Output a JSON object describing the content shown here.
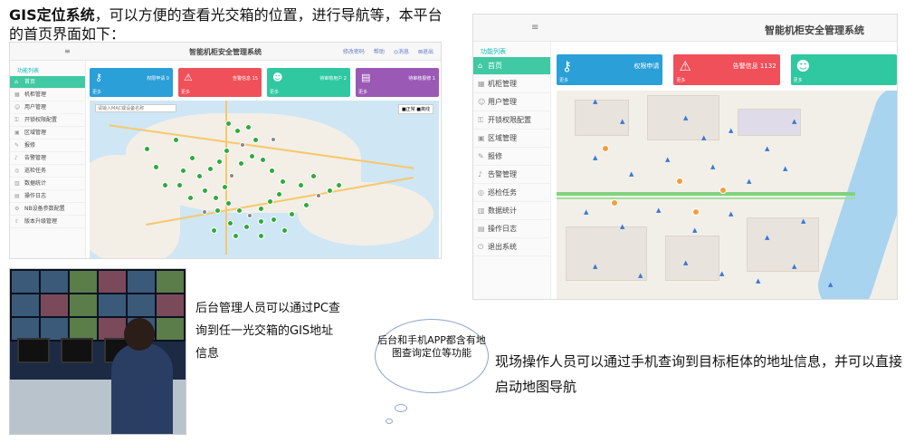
{
  "intro": {
    "bold": "GIS定位系统",
    "rest": "，可以方便的查看光交箱的位置，进行导航等，本平台的首页界面如下："
  },
  "left_shot": {
    "menu_icon": "≡",
    "title": "智能机柜安全管理系统",
    "links": [
      "修改密码",
      "帮助",
      "◎消息",
      "⊠退出"
    ],
    "sidebar_header": "功能列表",
    "sidebar": [
      {
        "label": "首页",
        "icon": "home-icon",
        "glyph": "⌂",
        "active": true
      },
      {
        "label": "机柜管理",
        "icon": "cabinet-icon",
        "glyph": "▦"
      },
      {
        "label": "用户管理",
        "icon": "user-icon",
        "glyph": "☺"
      },
      {
        "label": "开锁权限配置",
        "icon": "key-icon",
        "glyph": "⚿"
      },
      {
        "label": "区域管理",
        "icon": "region-icon",
        "glyph": "▣"
      },
      {
        "label": "报修",
        "icon": "wrench-icon",
        "glyph": "✎"
      },
      {
        "label": "告警管理",
        "icon": "bell-icon",
        "glyph": "♪"
      },
      {
        "label": "巡检任务",
        "icon": "task-icon",
        "glyph": "◎"
      },
      {
        "label": "数据统计",
        "icon": "chart-icon",
        "glyph": "▥"
      },
      {
        "label": "操作日志",
        "icon": "log-icon",
        "glyph": "▤"
      },
      {
        "label": "NB设备参数配置",
        "icon": "device-icon",
        "glyph": "⚙"
      },
      {
        "label": "版本升级管理",
        "icon": "upgrade-icon",
        "glyph": "⇧"
      }
    ],
    "cards": [
      {
        "label": "权限申请 0",
        "more": "更多",
        "color": "#2a9fd8",
        "icon": "key-icon",
        "glyph": "⚷"
      },
      {
        "label": "告警信息 15",
        "more": "更多",
        "color": "#f0505a",
        "icon": "warning-icon",
        "glyph": "⚠"
      },
      {
        "label": "待审核用户 2",
        "more": "更多",
        "color": "#2fc8a0",
        "icon": "user-icon",
        "glyph": "☻"
      },
      {
        "label": "待审核报修 1",
        "more": "更多",
        "color": "#9b59b6",
        "icon": "clipboard-icon",
        "glyph": "▤"
      }
    ],
    "map_search_placeholder": "请输入MAC或设备名称",
    "map_legend": "■正常 ■离线"
  },
  "right_shot": {
    "menu_icon": "≡",
    "title": "智能机柜安全管理系统",
    "sidebar_header": "功能列表",
    "sidebar": [
      {
        "label": "首页",
        "icon": "home-icon",
        "glyph": "⌂",
        "active": true
      },
      {
        "label": "机柜管理",
        "icon": "cabinet-icon",
        "glyph": "▦"
      },
      {
        "label": "用户管理",
        "icon": "user-icon",
        "glyph": "☺"
      },
      {
        "label": "开锁权限配置",
        "icon": "key-icon",
        "glyph": "⚿"
      },
      {
        "label": "区域管理",
        "icon": "region-icon",
        "glyph": "▣"
      },
      {
        "label": "报修",
        "icon": "wrench-icon",
        "glyph": "✎"
      },
      {
        "label": "告警管理",
        "icon": "bell-icon",
        "glyph": "♪"
      },
      {
        "label": "巡检任务",
        "icon": "task-icon",
        "glyph": "◎"
      },
      {
        "label": "数据统计",
        "icon": "chart-icon",
        "glyph": "▥"
      },
      {
        "label": "操作日志",
        "icon": "log-icon",
        "glyph": "▤"
      },
      {
        "label": "退出系统",
        "icon": "logout-icon",
        "glyph": "⏻"
      }
    ],
    "cards": [
      {
        "label": "权限申请",
        "more": "更多",
        "color": "#2a9fd8",
        "icon": "key-icon",
        "glyph": "⚷"
      },
      {
        "label": "告警信息 1132",
        "more": "更多",
        "color": "#f0505a",
        "icon": "warning-icon",
        "glyph": "⚠"
      },
      {
        "label": "",
        "more": "更多",
        "color": "#2fc8a0",
        "icon": "user-icon",
        "glyph": "☻"
      }
    ]
  },
  "captions": {
    "pc": "后台管理人员可以通过PC查询到任一光交箱的GIS地址信息",
    "bubble": "后台和手机APP都含有地图查询定位等功能",
    "field": "现场操作人员可以通过手机查询到目标柜体的地址信息，并可以直接启动地图导航"
  }
}
